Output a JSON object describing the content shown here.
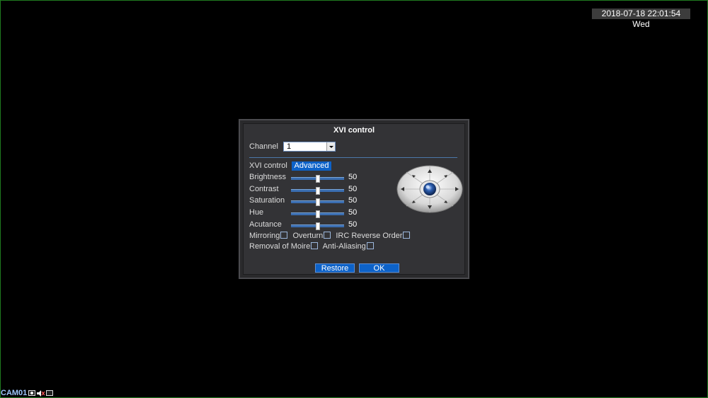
{
  "overlay": {
    "datetime": "2018-07-18 22:01:54 Wed",
    "camera_label": "CAM01"
  },
  "dialog": {
    "title": "XVI control",
    "channel_label": "Channel",
    "channel_value": "1",
    "xvi_label": "XVI control",
    "advanced_label": "Advanced",
    "sliders": [
      {
        "label": "Brightness",
        "value": "50",
        "level": 50
      },
      {
        "label": "Contrast",
        "value": "50",
        "level": 50
      },
      {
        "label": "Saturation",
        "value": "50",
        "level": 50
      },
      {
        "label": "Hue",
        "value": "50",
        "level": 50
      },
      {
        "label": "Acutance",
        "value": "50",
        "level": 50
      }
    ],
    "checkboxes": {
      "mirroring": "Mirroring",
      "overturn": "Overturn",
      "irc_reverse": "IRC Reverse Order",
      "removal_moire": "Removal of Moire",
      "anti_aliasing": "Anti-Aliasing"
    },
    "restore_label": "Restore",
    "ok_label": "OK"
  },
  "colors": {
    "accent": "#0d62c8",
    "frame": "#1f7a1f"
  }
}
